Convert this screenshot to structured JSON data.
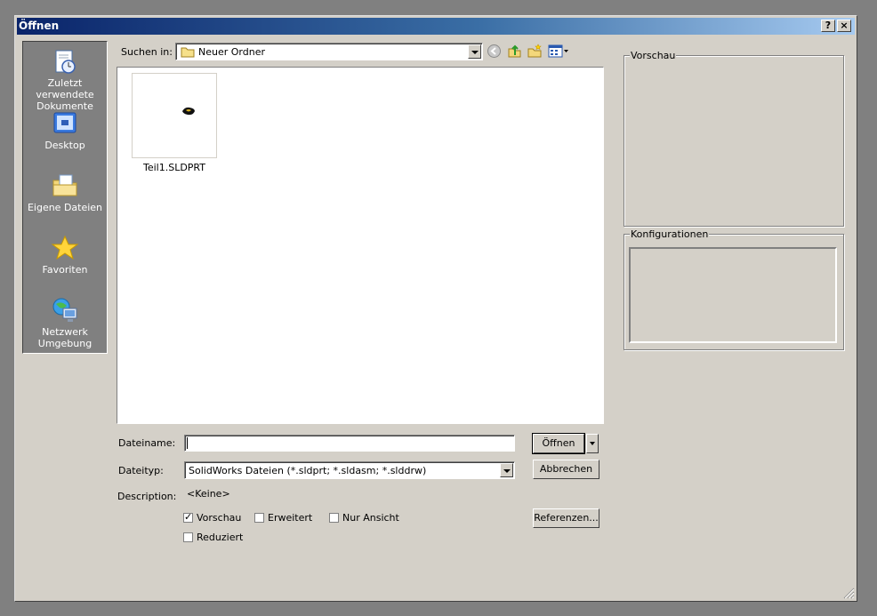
{
  "window": {
    "title": "Öffnen"
  },
  "titlebar": {
    "help_label": "?",
    "close_label": "×"
  },
  "places": [
    {
      "label": "Zuletzt verwendete Dokumente",
      "icon": "recent-documents-icon"
    },
    {
      "label": "Desktop",
      "icon": "desktop-icon"
    },
    {
      "label": "Eigene Dateien",
      "icon": "my-documents-icon"
    },
    {
      "label": "Favoriten",
      "icon": "favorites-icon"
    },
    {
      "label": "Netzwerk Umgebung",
      "icon": "network-icon"
    }
  ],
  "lookin": {
    "label": "Suchen in:",
    "value": "Neuer Ordner"
  },
  "toolbar": {
    "icons": [
      "back-icon",
      "up-folder-icon",
      "new-folder-icon",
      "view-menu-icon"
    ]
  },
  "files": [
    {
      "name": "Teil1.SLDPRT"
    }
  ],
  "filename": {
    "label": "Dateiname:",
    "value": ""
  },
  "filetype": {
    "label": "Dateityp:",
    "value": "SolidWorks Dateien (*.sldprt; *.sldasm; *.slddrw)"
  },
  "description": {
    "label": "Description:",
    "value": "<Keine>"
  },
  "buttons": {
    "open": "Öffnen",
    "cancel": "Abbrechen",
    "references": "Referenzen..."
  },
  "options": {
    "preview": {
      "label": "Vorschau",
      "checked": true
    },
    "advanced": {
      "label": "Erweitert",
      "checked": false
    },
    "readonly": {
      "label": "Nur Ansicht",
      "checked": false
    },
    "reduced": {
      "label": "Reduziert",
      "checked": false
    }
  },
  "preview_panel": {
    "label": "Vorschau"
  },
  "config_panel": {
    "label": "Konfigurationen"
  },
  "colors": {
    "title_start": "#0a246a",
    "title_end": "#a6caf0",
    "face": "#d4d0c8"
  }
}
